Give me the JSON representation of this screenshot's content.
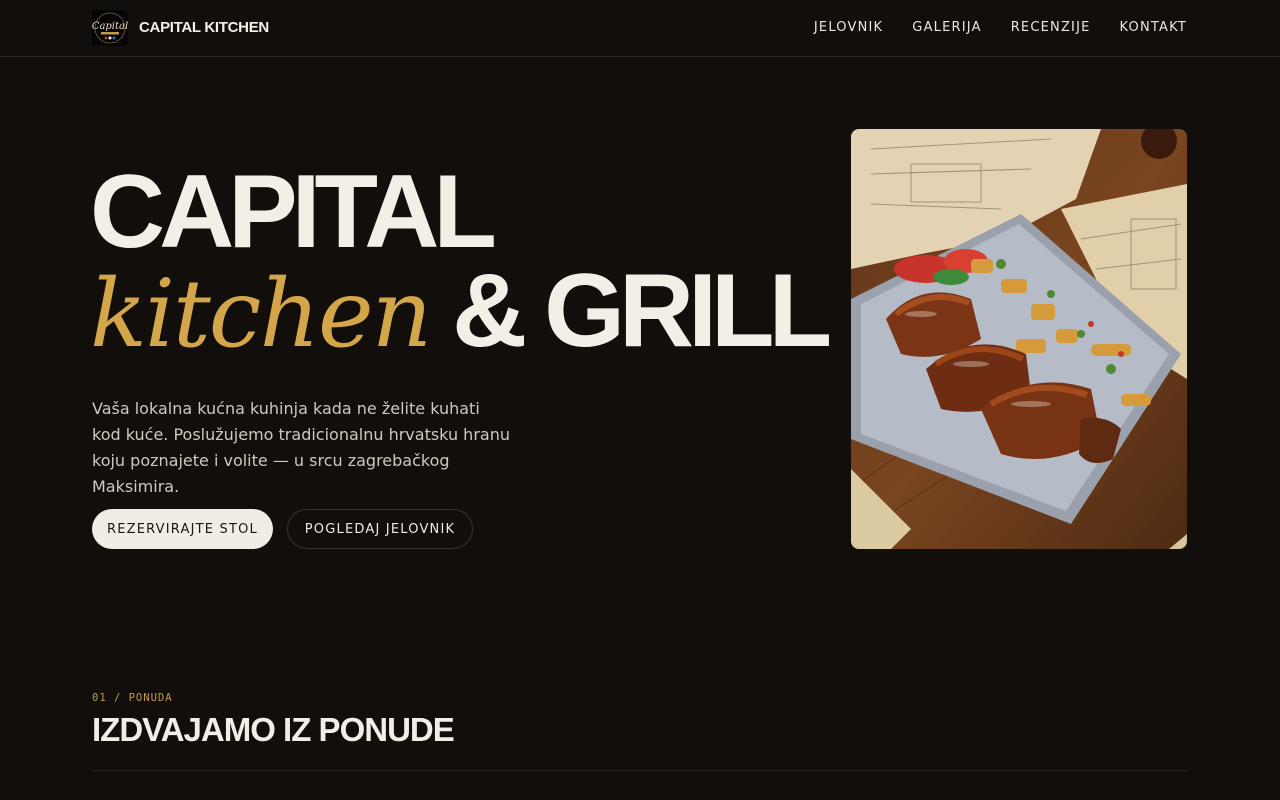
{
  "brand": {
    "name": "CAPITAL KITCHEN",
    "logo_text": "Capital"
  },
  "nav": {
    "items": [
      "JELOVNIK",
      "GALERIJA",
      "RECENZIJE",
      "KONTAKT"
    ]
  },
  "hero": {
    "title_line1": "CAPITAL",
    "title_script": "kitchen",
    "title_line2_rest": "& GRILL",
    "description": "Vaša lokalna kućna kuhinja kada ne želite kuhati kod kuće. Poslužujemo tradicionalnu hrvatsku hranu koju poznajete i volite — u srcu zagrebačkog Maksimira.",
    "primary_button": "REZERVIRAJTE STOL",
    "secondary_button": "POGLEDAJ JELOVNIK",
    "photo_icon": "food-plate-photo"
  },
  "section": {
    "eyebrow": "01 / PONUDA",
    "title": "IZDVAJAMO IZ PONUDE"
  },
  "colors": {
    "background": "#110e0c",
    "accent": "#d4a64a",
    "text": "#f2eee6"
  }
}
